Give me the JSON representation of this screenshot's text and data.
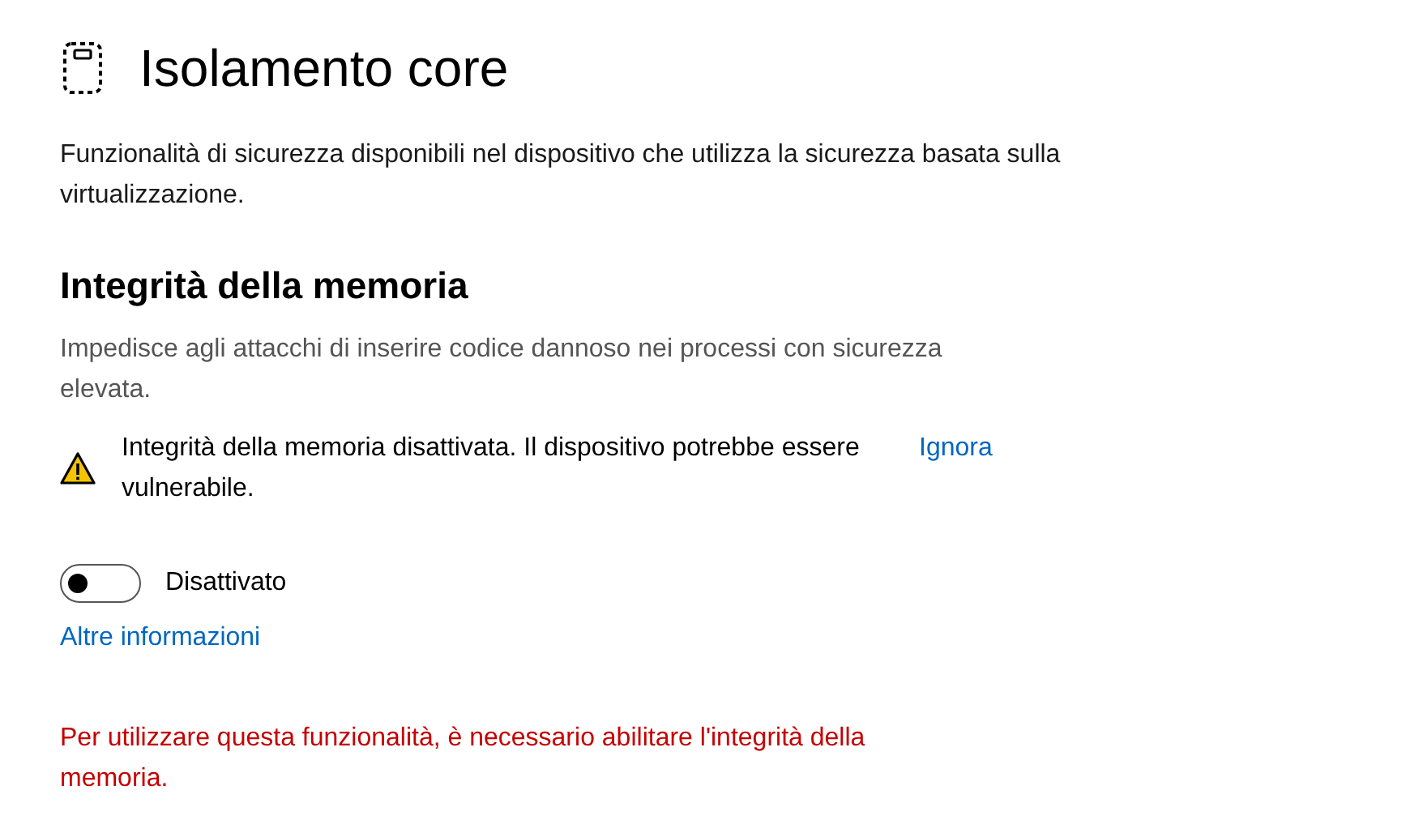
{
  "title": "Isolamento core",
  "description": "Funzionalità di sicurezza disponibili nel dispositivo che utilizza la sicurezza basata sulla virtualizzazione.",
  "section": {
    "heading": "Integrità della memoria",
    "description": "Impedisce agli attacchi di inserire codice dannoso nei processi con sicurezza elevata.",
    "warning": {
      "text": "Integrità della memoria disattivata. Il dispositivo potrebbe essere vulnerabile.",
      "action": "Ignora"
    },
    "toggle": {
      "on": false,
      "label": "Disattivato"
    },
    "link": "Altre informazioni",
    "error": "Per utilizzare questa funzionalità, è necessario abilitare l'integrità della memoria."
  }
}
